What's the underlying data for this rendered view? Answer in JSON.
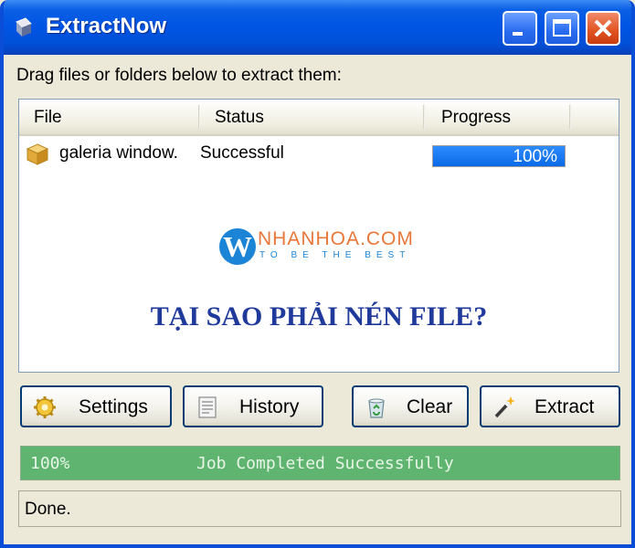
{
  "window": {
    "title": "ExtractNow",
    "icon": "extractnow-app-icon",
    "controls": [
      "minimize-icon",
      "maximize-icon",
      "close-icon"
    ]
  },
  "instruction": "Drag files or folders below to extract them:",
  "list": {
    "columns": [
      "File",
      "Status",
      "Progress"
    ],
    "rows": [
      {
        "icon": "archive-cube-icon",
        "file": "galeria window.",
        "status": "Successful",
        "progress": 100,
        "progress_text": "100%"
      }
    ]
  },
  "watermark": {
    "logo_letter": "W",
    "brand": "NHANHOA.COM",
    "tagline": "TO BE THE BEST"
  },
  "headline": "TẠI SAO PHẢI NÉN FILE?",
  "buttons": {
    "settings": "Settings",
    "history": "History",
    "clear": "Clear",
    "extract": "Extract"
  },
  "job_status": {
    "percent": "100%",
    "message": "Job Completed Successfully"
  },
  "status_text": "Done.",
  "colors": {
    "titlebar": "#0054e3",
    "progress_fill": "#0a6ae6",
    "status_bar_fill": "#5fb46f",
    "headline": "#1f3a9a",
    "brand_orange": "#e9773a",
    "brand_blue": "#1b84d6"
  }
}
